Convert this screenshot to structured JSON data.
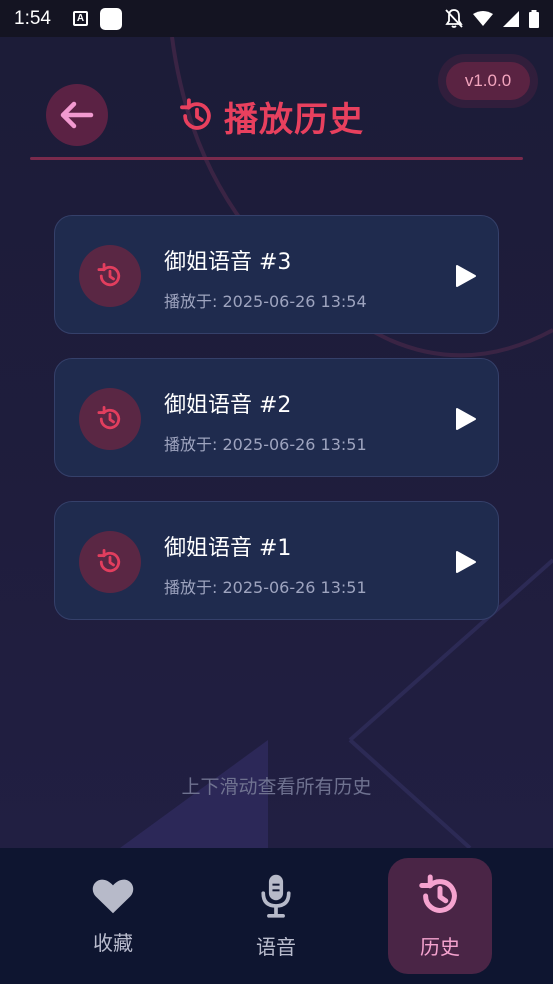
{
  "status_bar": {
    "time": "1:54"
  },
  "header": {
    "title": "播放历史",
    "version": "v1.0.0"
  },
  "history": [
    {
      "title": "御姐语音 #3",
      "time": "播放于: 2025-06-26 13:54"
    },
    {
      "title": "御姐语音 #2",
      "time": "播放于: 2025-06-26 13:51"
    },
    {
      "title": "御姐语音 #1",
      "time": "播放于: 2025-06-26 13:51"
    }
  ],
  "scroll_hint": "上下滑动查看所有历史",
  "bottom_nav": {
    "items": [
      {
        "label": "收藏",
        "icon": "heart-icon"
      },
      {
        "label": "语音",
        "icon": "microphone-icon"
      },
      {
        "label": "历史",
        "icon": "history-icon",
        "active": true
      }
    ]
  },
  "colors": {
    "accent": "#e8405e",
    "active_nav_bg": "#4a2546",
    "card_bg": "#1f2b4e",
    "background": "#1d1c38"
  }
}
